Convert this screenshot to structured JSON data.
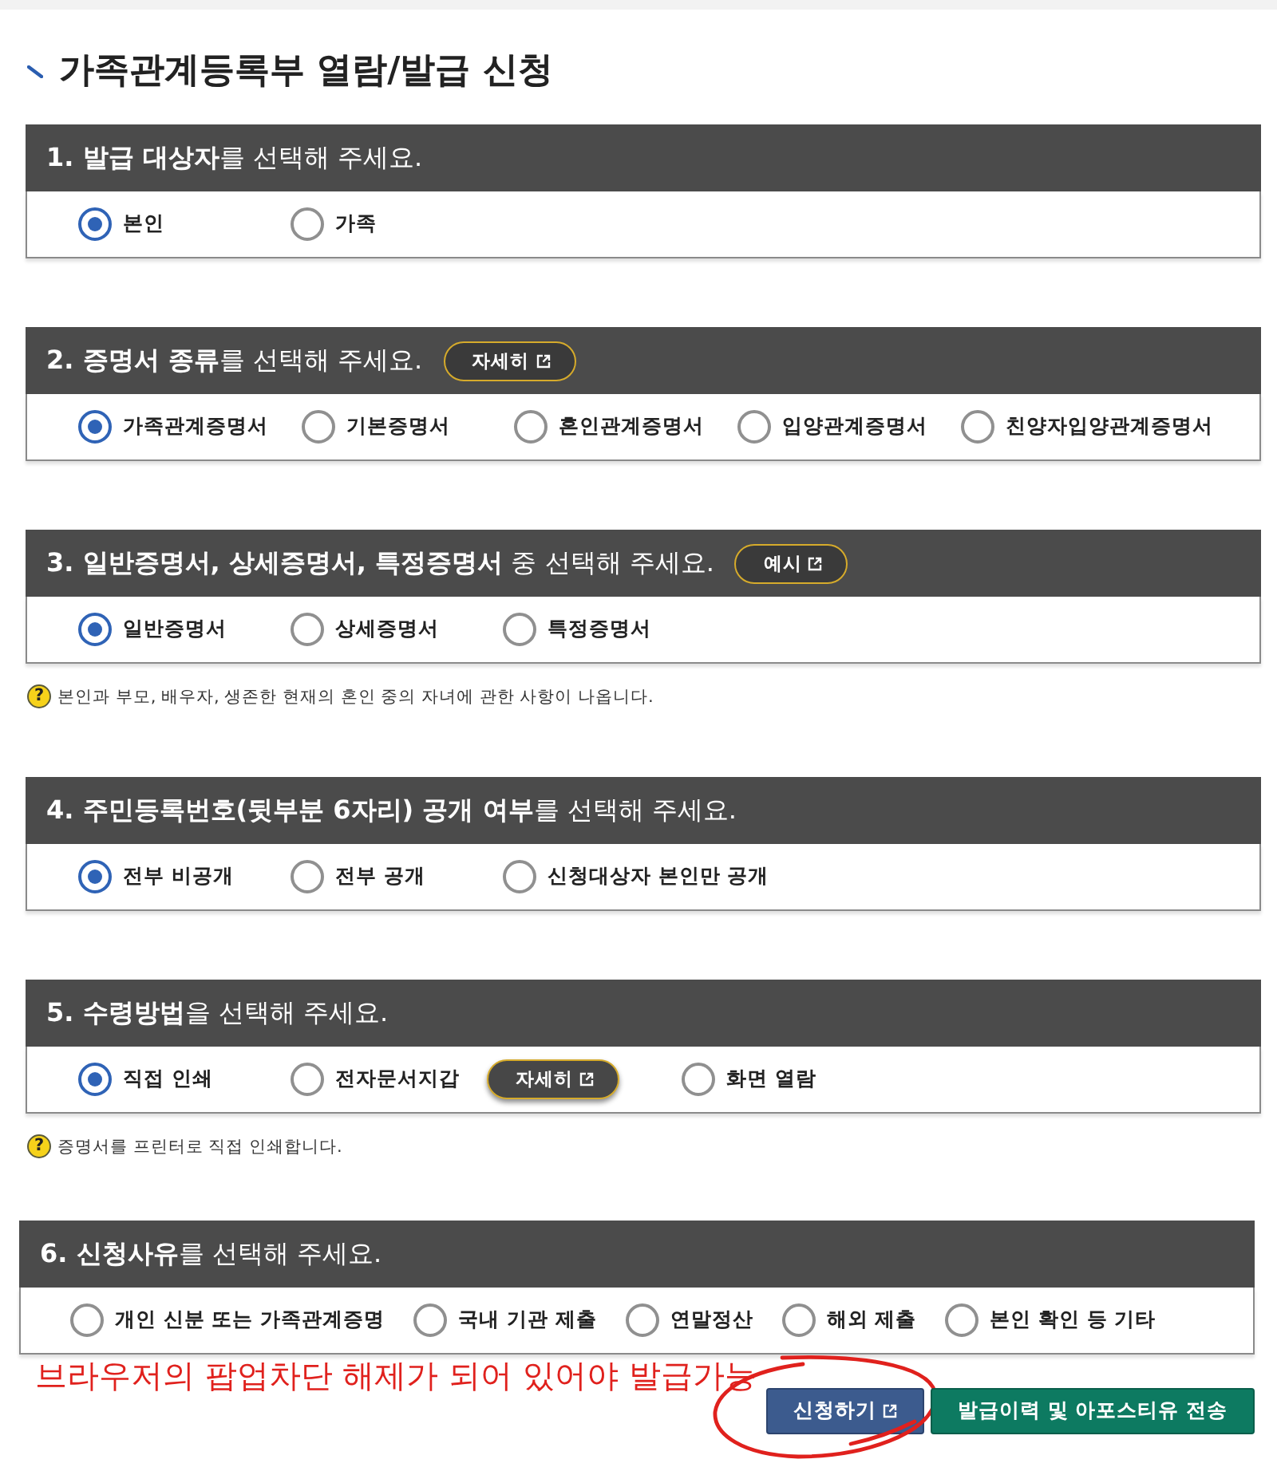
{
  "title": "가족관계등록부 열람/발급 신청",
  "sections": [
    {
      "heading": "**1. 발급 대상자**를 선택해 주세요.",
      "options": [
        {
          "label": "본인",
          "selected": true
        },
        {
          "label": "가족",
          "selected": false
        }
      ]
    },
    {
      "heading": "**2. 증명서 종류**를 선택해 주세요.",
      "heading_button": {
        "label": "자세히",
        "external": true
      },
      "options": [
        {
          "label": "가족관계증명서",
          "selected": true
        },
        {
          "label": "기본증명서",
          "selected": false
        },
        {
          "label": "혼인관계증명서",
          "selected": false
        },
        {
          "label": "입양관계증명서",
          "selected": false
        },
        {
          "label": "친양자입양관계증명서",
          "selected": false
        }
      ]
    },
    {
      "heading": "**3. 일반증명서, 상세증명서, 특정증명서** 중 선택해 주세요.",
      "heading_button": {
        "label": "예시",
        "external": true
      },
      "options": [
        {
          "label": "일반증명서",
          "selected": true
        },
        {
          "label": "상세증명서",
          "selected": false
        },
        {
          "label": "특정증명서",
          "selected": false
        }
      ],
      "note": {
        "icon": "?",
        "text": "본인과 부모, 배우자, 생존한 현재의 혼인 중의 자녀에 관한 사항이 나옵니다."
      }
    },
    {
      "heading": "**4. 주민등록번호(뒷부분 6자리) 공개 여부**를 선택해 주세요.",
      "options": [
        {
          "label": "전부 비공개",
          "selected": true
        },
        {
          "label": "전부 공개",
          "selected": false
        },
        {
          "label": "신청대상자 본인만 공개",
          "selected": false
        }
      ]
    },
    {
      "heading": "**5. 수령방법**을 선택해 주세요.",
      "options": [
        {
          "label": "직접 인쇄",
          "selected": true
        },
        {
          "label": "전자문서지갑",
          "selected": false,
          "detail_button": {
            "label": "자세히",
            "external": true
          }
        },
        {
          "label": "화면 열람",
          "selected": false
        }
      ],
      "note": {
        "icon": "?",
        "text": "증명서를 프린터로 직접 인쇄합니다."
      }
    },
    {
      "heading": "**6. 신청사유**를 선택해 주세요.",
      "options": [
        {
          "label": "개인 신분 또는 가족관계증명",
          "selected": false
        },
        {
          "label": "국내 기관 제출",
          "selected": false
        },
        {
          "label": "연말정산",
          "selected": false
        },
        {
          "label": "해외 제출",
          "selected": false
        },
        {
          "label": "본인 확인 등 기타",
          "selected": false
        }
      ]
    }
  ],
  "annotation": {
    "text": "브라우저의 팝업차단 해제가 되어 있어야 발급가능"
  },
  "actions": [
    {
      "label": "신청하기",
      "kind": "primary",
      "external": true,
      "circled": true
    },
    {
      "label": "발급이력 및 아포스티유 전송",
      "kind": "secondary",
      "external": false,
      "circled": false
    }
  ]
}
